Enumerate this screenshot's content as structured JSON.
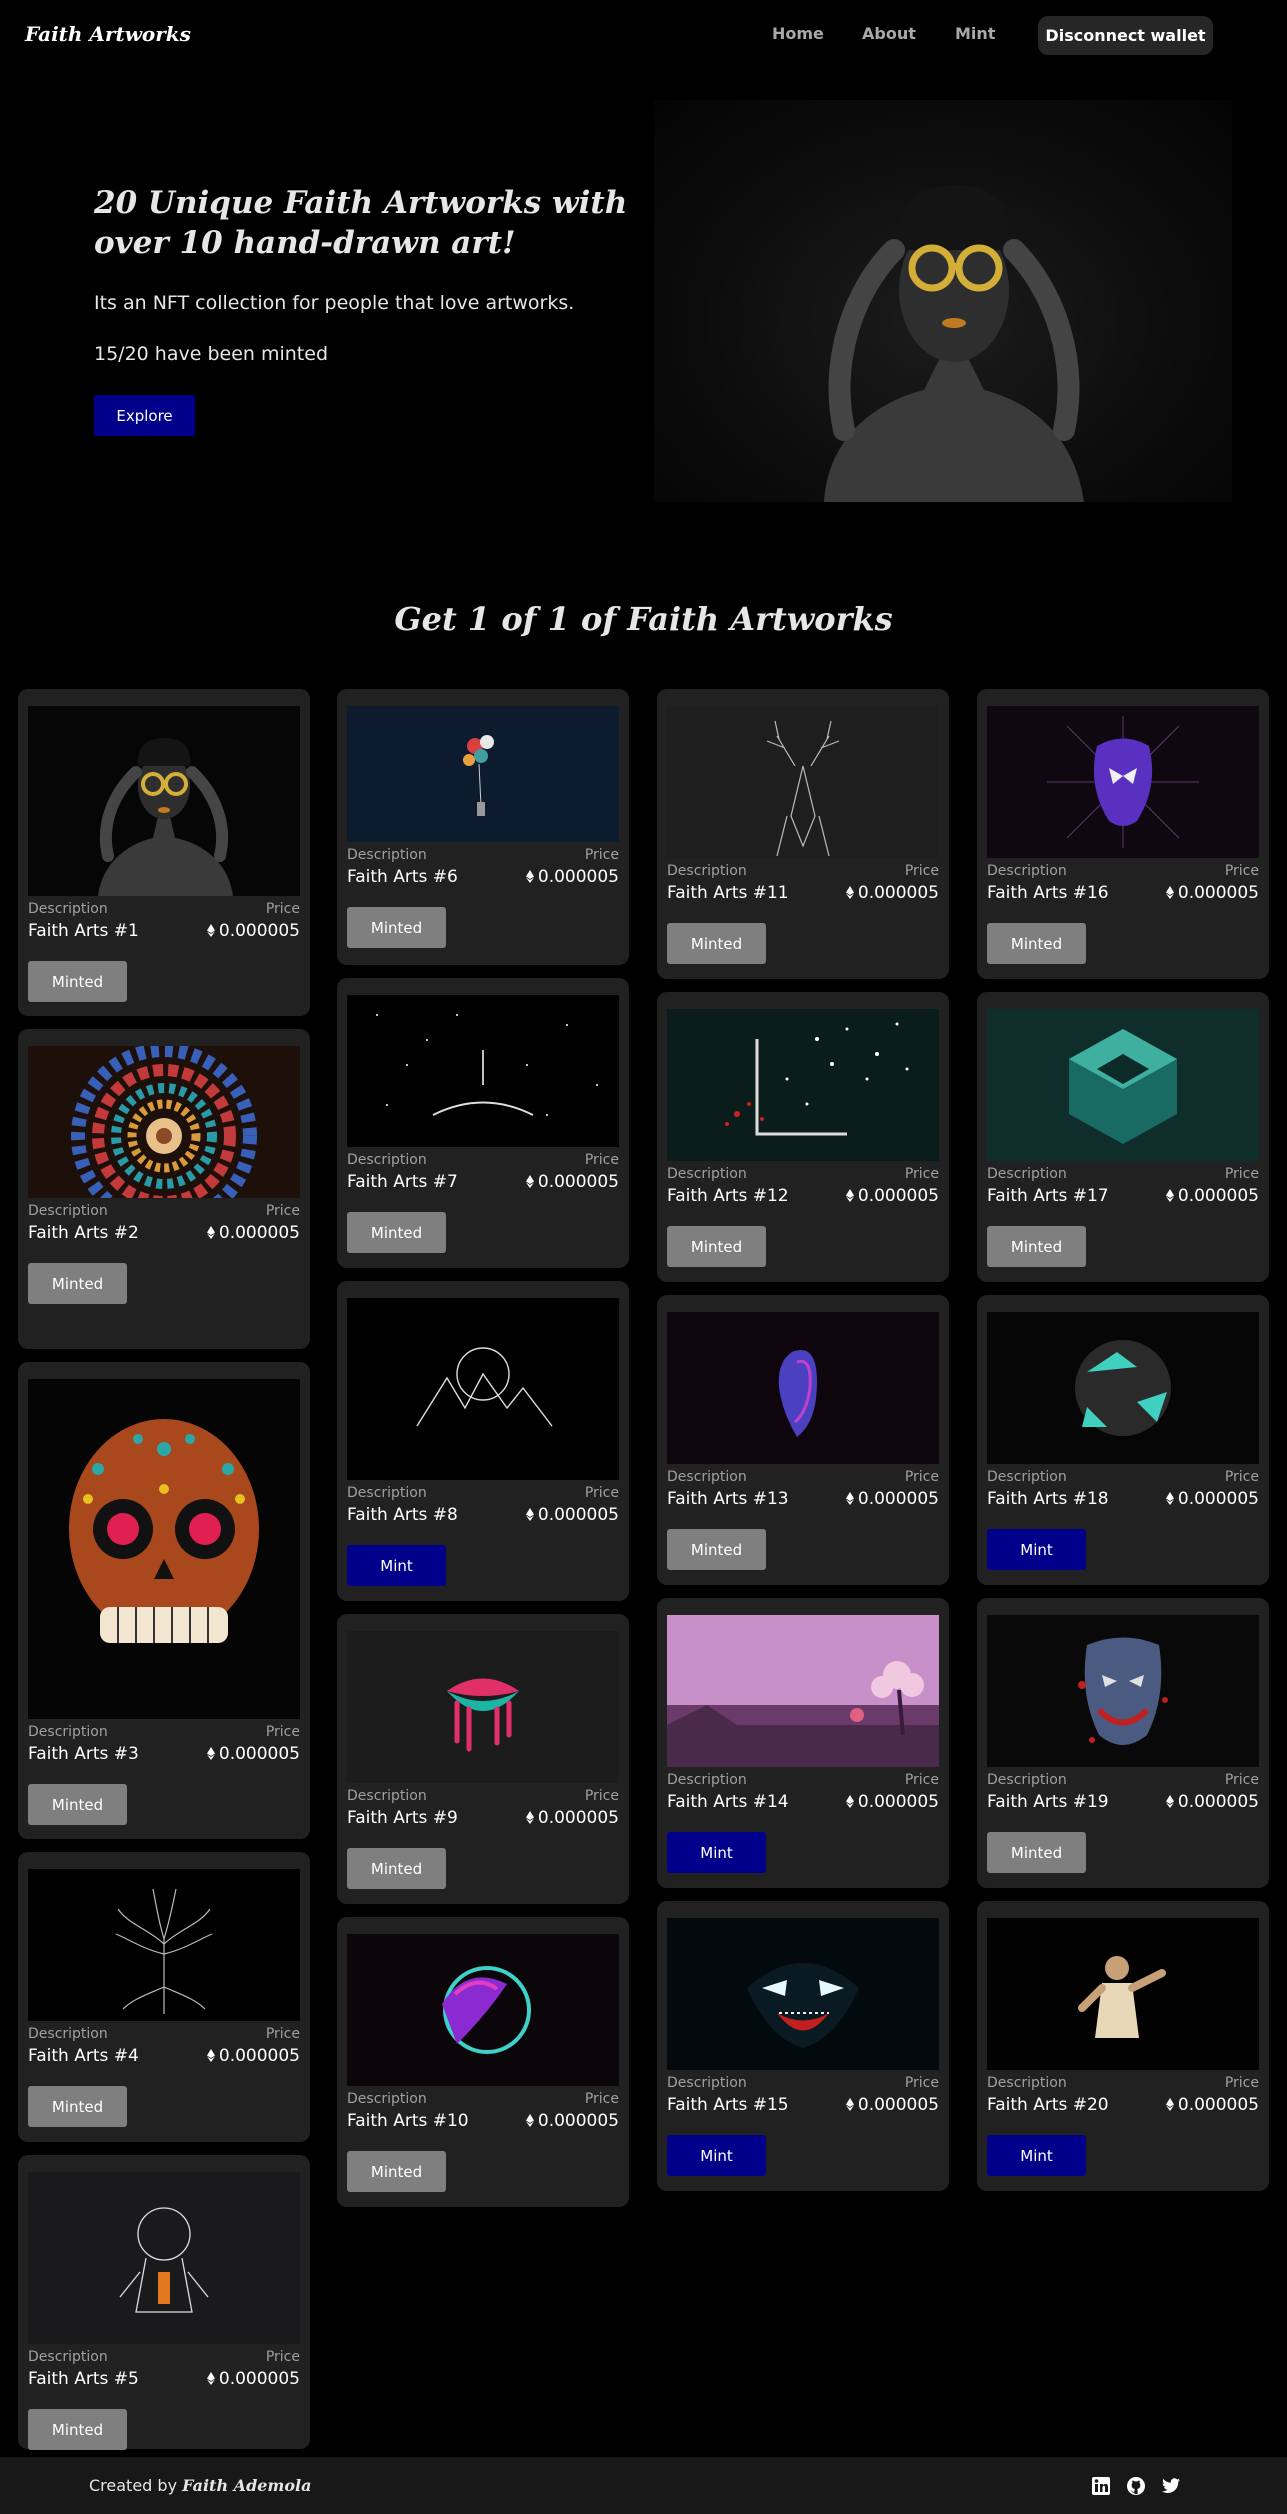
{
  "nav": {
    "brand": "Faith Artworks",
    "links": [
      "Home",
      "About",
      "Mint"
    ],
    "wallet_button": "Disconnect wallet"
  },
  "hero": {
    "title": "20 Unique Faith Artworks with over 10 hand-drawn art!",
    "subtitle": "Its an NFT collection for people that love artworks.",
    "minted_count": "15/20 have been minted",
    "explore_button": "Explore"
  },
  "gallery": {
    "title": "Get 1 of 1 of Faith Artworks",
    "description_label": "Description",
    "price_label": "Price",
    "cards": [
      {
        "name": "Faith Arts #1",
        "price": "0.000005",
        "button": "Minted",
        "art": "woman-glasses-icon"
      },
      {
        "name": "Faith Arts #2",
        "price": "0.000005",
        "button": "Minted",
        "art": "stained-glass-icon"
      },
      {
        "name": "Faith Arts #3",
        "price": "0.000005",
        "button": "Minted",
        "art": "sugar-skull-icon"
      },
      {
        "name": "Faith Arts #4",
        "price": "0.000005",
        "button": "Minted",
        "art": "tree-icon"
      },
      {
        "name": "Faith Arts #5",
        "price": "0.000005",
        "button": "Minted",
        "art": "astronaut-icon"
      },
      {
        "name": "Faith Arts #6",
        "price": "0.000005",
        "button": "Minted",
        "art": "balloons-icon"
      },
      {
        "name": "Faith Arts #7",
        "price": "0.000005",
        "button": "Minted",
        "art": "starfield-icon"
      },
      {
        "name": "Faith Arts #8",
        "price": "0.000005",
        "button": "Mint",
        "art": "mountains-icon"
      },
      {
        "name": "Faith Arts #9",
        "price": "0.000005",
        "button": "Minted",
        "art": "lips-icon"
      },
      {
        "name": "Faith Arts #10",
        "price": "0.000005",
        "button": "Minted",
        "art": "neon-panther-icon"
      },
      {
        "name": "Faith Arts #11",
        "price": "0.000005",
        "button": "Minted",
        "art": "deer-icon"
      },
      {
        "name": "Faith Arts #12",
        "price": "0.000005",
        "button": "Minted",
        "art": "particle-frame-icon"
      },
      {
        "name": "Faith Arts #13",
        "price": "0.000005",
        "button": "Minted",
        "art": "neon-face-icon"
      },
      {
        "name": "Faith Arts #14",
        "price": "0.000005",
        "button": "Mint",
        "art": "pink-landscape-icon"
      },
      {
        "name": "Faith Arts #15",
        "price": "0.000005",
        "button": "Mint",
        "art": "venom-icon"
      },
      {
        "name": "Faith Arts #16",
        "price": "0.000005",
        "button": "Minted",
        "art": "spider-mask-icon"
      },
      {
        "name": "Faith Arts #17",
        "price": "0.000005",
        "button": "Minted",
        "art": "teal-cube-icon"
      },
      {
        "name": "Faith Arts #18",
        "price": "0.000005",
        "button": "Mint",
        "art": "teal-sphere-icon"
      },
      {
        "name": "Faith Arts #19",
        "price": "0.000005",
        "button": "Minted",
        "art": "joker-icon"
      },
      {
        "name": "Faith Arts #20",
        "price": "0.000005",
        "button": "Mint",
        "art": "fighter-icon"
      }
    ]
  },
  "footer": {
    "created_by": "Created by",
    "author": "Faith Ademola",
    "icons": [
      "linkedin-icon",
      "github-icon",
      "twitter-icon"
    ]
  },
  "colors": {
    "background": "#000000",
    "card": "#212121",
    "mint_button": "#00008b",
    "minted_button": "#7f7f7f",
    "footer": "#181818"
  }
}
